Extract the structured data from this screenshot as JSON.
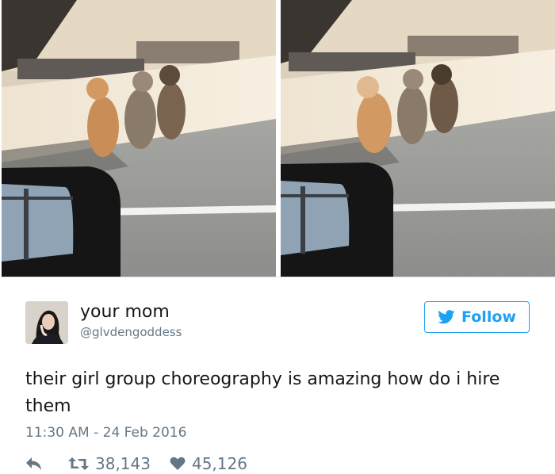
{
  "tweet": {
    "author_name": "your mom",
    "author_handle": "@glvdengoddess",
    "follow_label": "Follow",
    "text": "their girl group choreography is amazing how do i hire them",
    "timestamp": "11:30 AM - 24 Feb 2016",
    "retweet_count": "38,143",
    "like_count": "45,126"
  },
  "colors": {
    "accent": "#1da1f2",
    "muted": "#657786",
    "text": "#14171a"
  },
  "icons": {
    "reply": "reply-icon",
    "retweet": "retweet-icon",
    "like": "heart-icon",
    "follow": "twitter-bird-icon"
  }
}
